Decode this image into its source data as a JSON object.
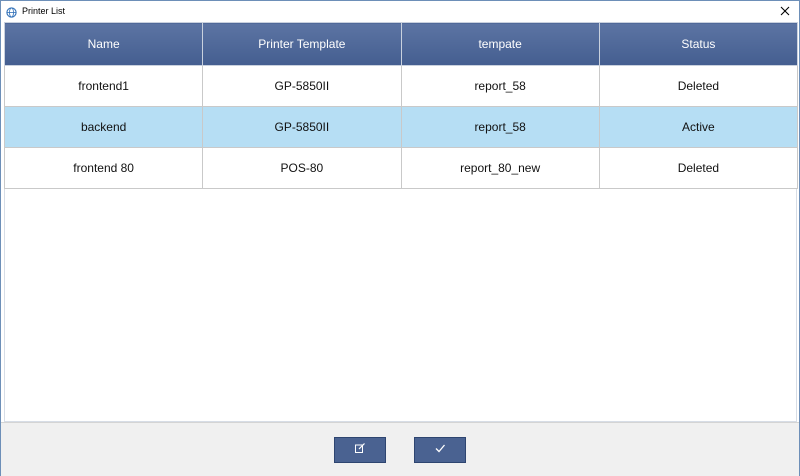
{
  "window": {
    "title": "Printer List",
    "icons": {
      "app": "globe-icon",
      "close": "close-icon"
    }
  },
  "table": {
    "columns": [
      "Name",
      "Printer Template",
      "tempate",
      "Status"
    ],
    "rows": [
      {
        "name": "frontend1",
        "printer_template": "GP-5850II",
        "template": "report_58",
        "status": "Deleted",
        "selected": false
      },
      {
        "name": "backend",
        "printer_template": "GP-5850II",
        "template": "report_58",
        "status": "Active",
        "selected": true
      },
      {
        "name": "frontend 80",
        "printer_template": "POS-80",
        "template": "report_80_new",
        "status": "Deleted",
        "selected": false
      }
    ]
  },
  "footer": {
    "buttons": [
      {
        "icon": "edit-icon"
      },
      {
        "icon": "checkmark-icon"
      }
    ]
  },
  "colors": {
    "header": "#4f6898",
    "selected_row": "#b6def4",
    "button": "#4a6291"
  }
}
